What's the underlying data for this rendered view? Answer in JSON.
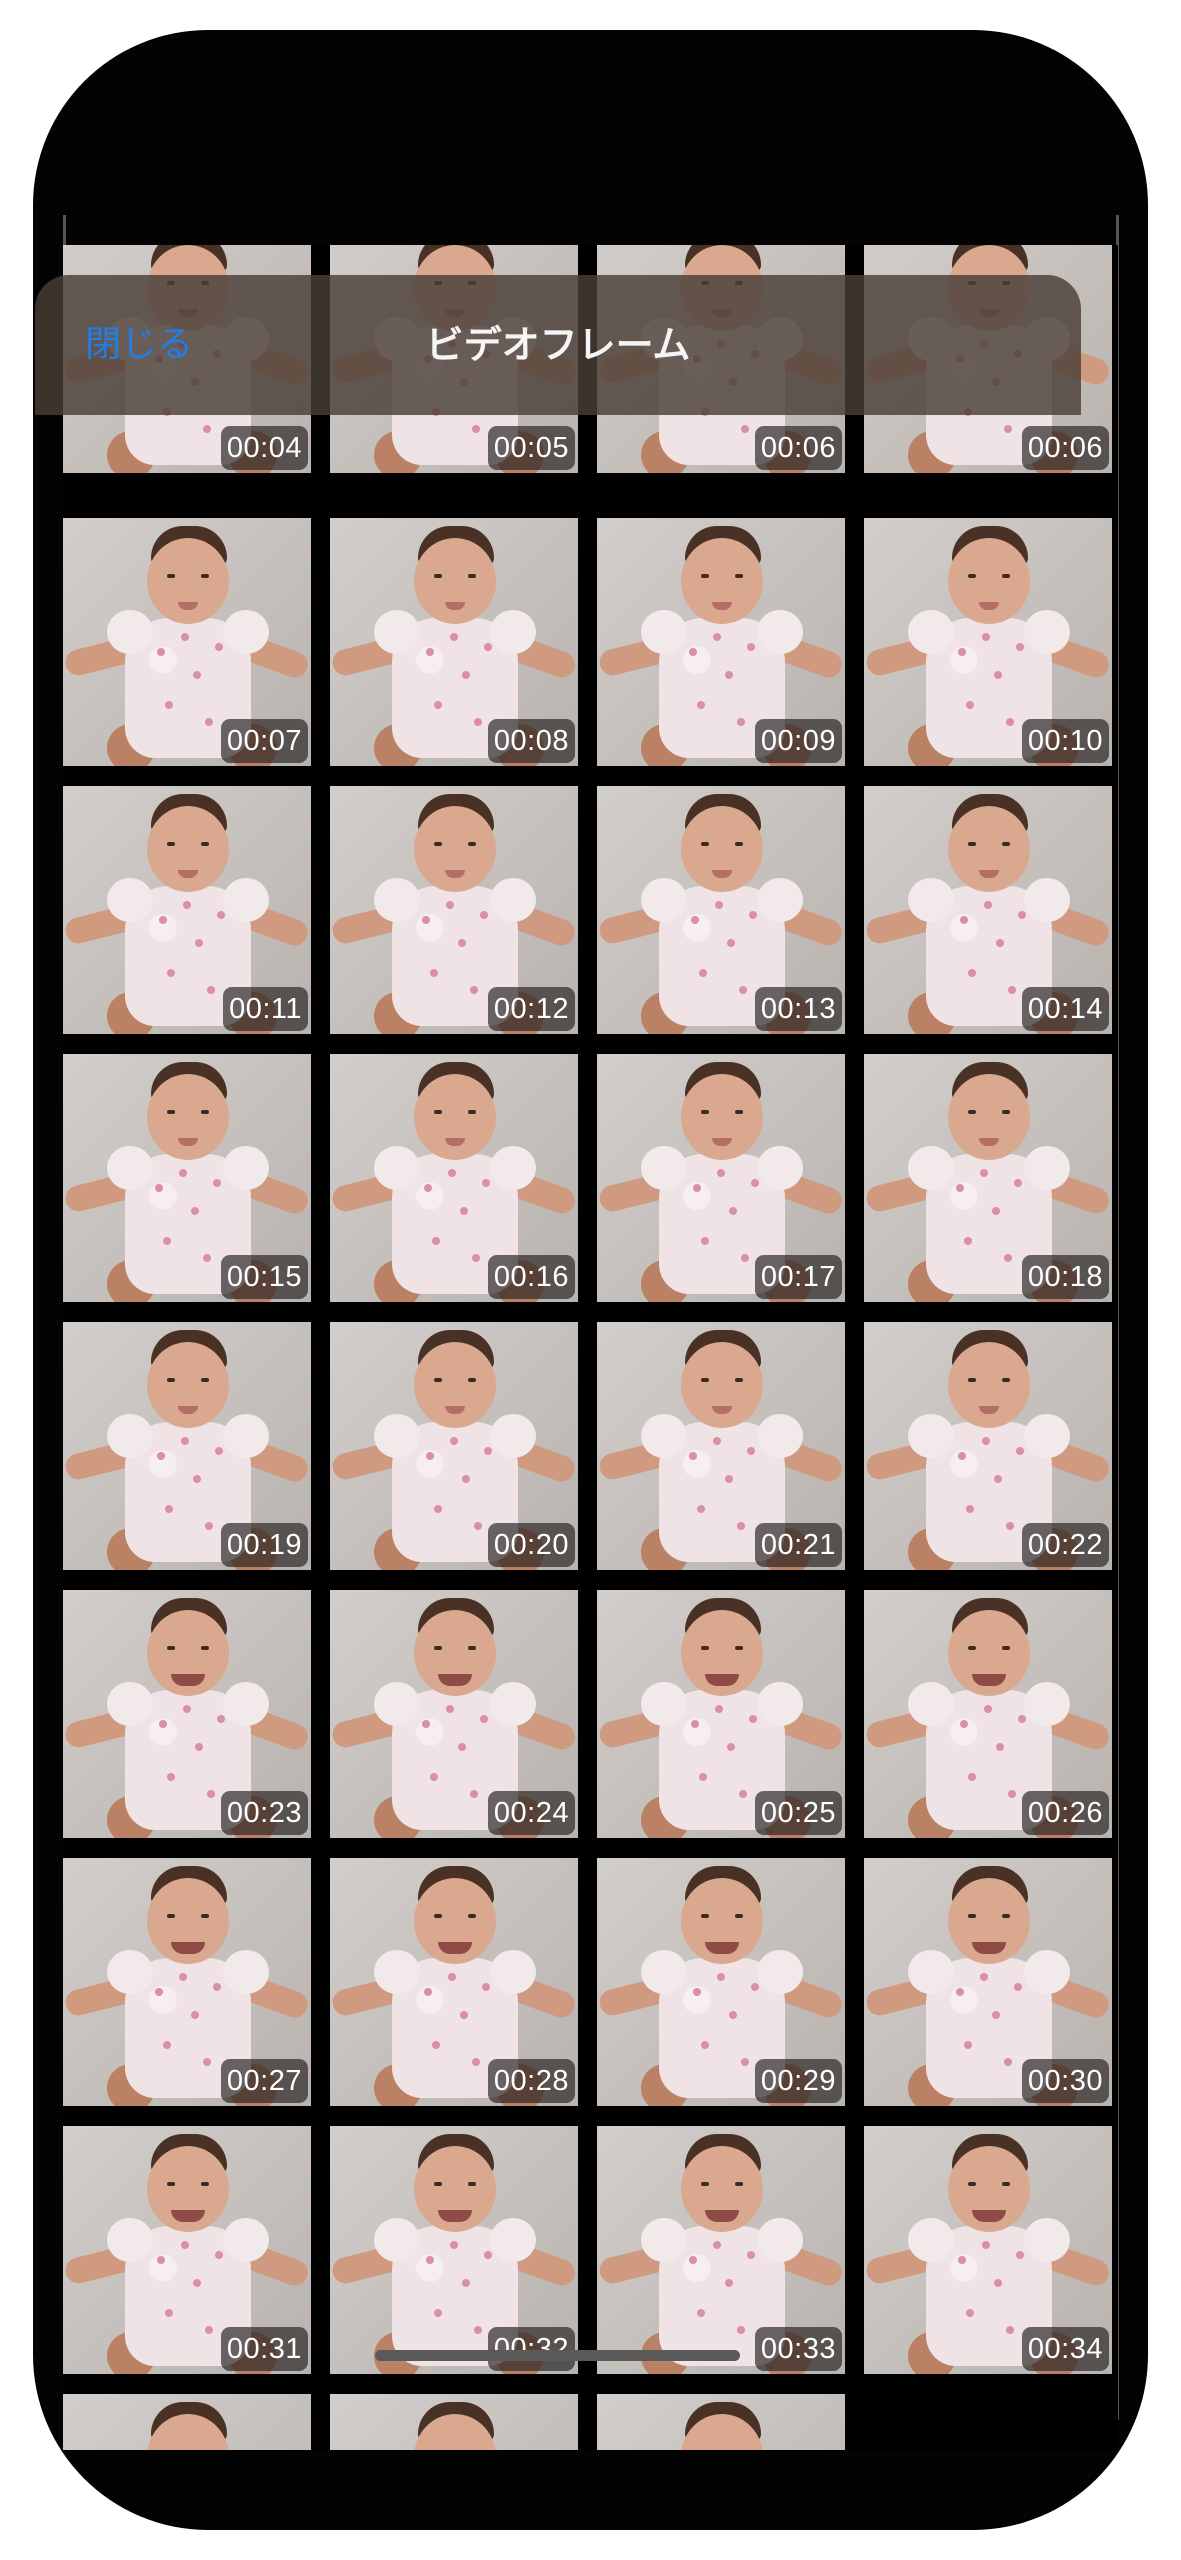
{
  "nav": {
    "close_label": "閉じる",
    "title": "ビデオフレーム"
  },
  "colors": {
    "accent": "#1f7fe6",
    "background": "#000000",
    "nav_bar": "#4a3e37"
  },
  "frames": [
    {
      "time": "00:04",
      "partial": "top"
    },
    {
      "time": "00:05",
      "partial": "top"
    },
    {
      "time": "00:06",
      "partial": "top"
    },
    {
      "time": "00:06",
      "partial": "top"
    },
    {
      "time": "00:07"
    },
    {
      "time": "00:08"
    },
    {
      "time": "00:09"
    },
    {
      "time": "00:10"
    },
    {
      "time": "00:11"
    },
    {
      "time": "00:12"
    },
    {
      "time": "00:13"
    },
    {
      "time": "00:14"
    },
    {
      "time": "00:15"
    },
    {
      "time": "00:16"
    },
    {
      "time": "00:17"
    },
    {
      "time": "00:18"
    },
    {
      "time": "00:19"
    },
    {
      "time": "00:20"
    },
    {
      "time": "00:21"
    },
    {
      "time": "00:22"
    },
    {
      "time": "00:23"
    },
    {
      "time": "00:24"
    },
    {
      "time": "00:25"
    },
    {
      "time": "00:26"
    },
    {
      "time": "00:27"
    },
    {
      "time": "00:28"
    },
    {
      "time": "00:29"
    },
    {
      "time": "00:30"
    },
    {
      "time": "00:31"
    },
    {
      "time": "00:32"
    },
    {
      "time": "00:33"
    },
    {
      "time": "00:34"
    },
    {
      "time": "",
      "partial": "bottom"
    },
    {
      "time": "",
      "partial": "bottom"
    },
    {
      "time": "",
      "partial": "bottom"
    }
  ]
}
